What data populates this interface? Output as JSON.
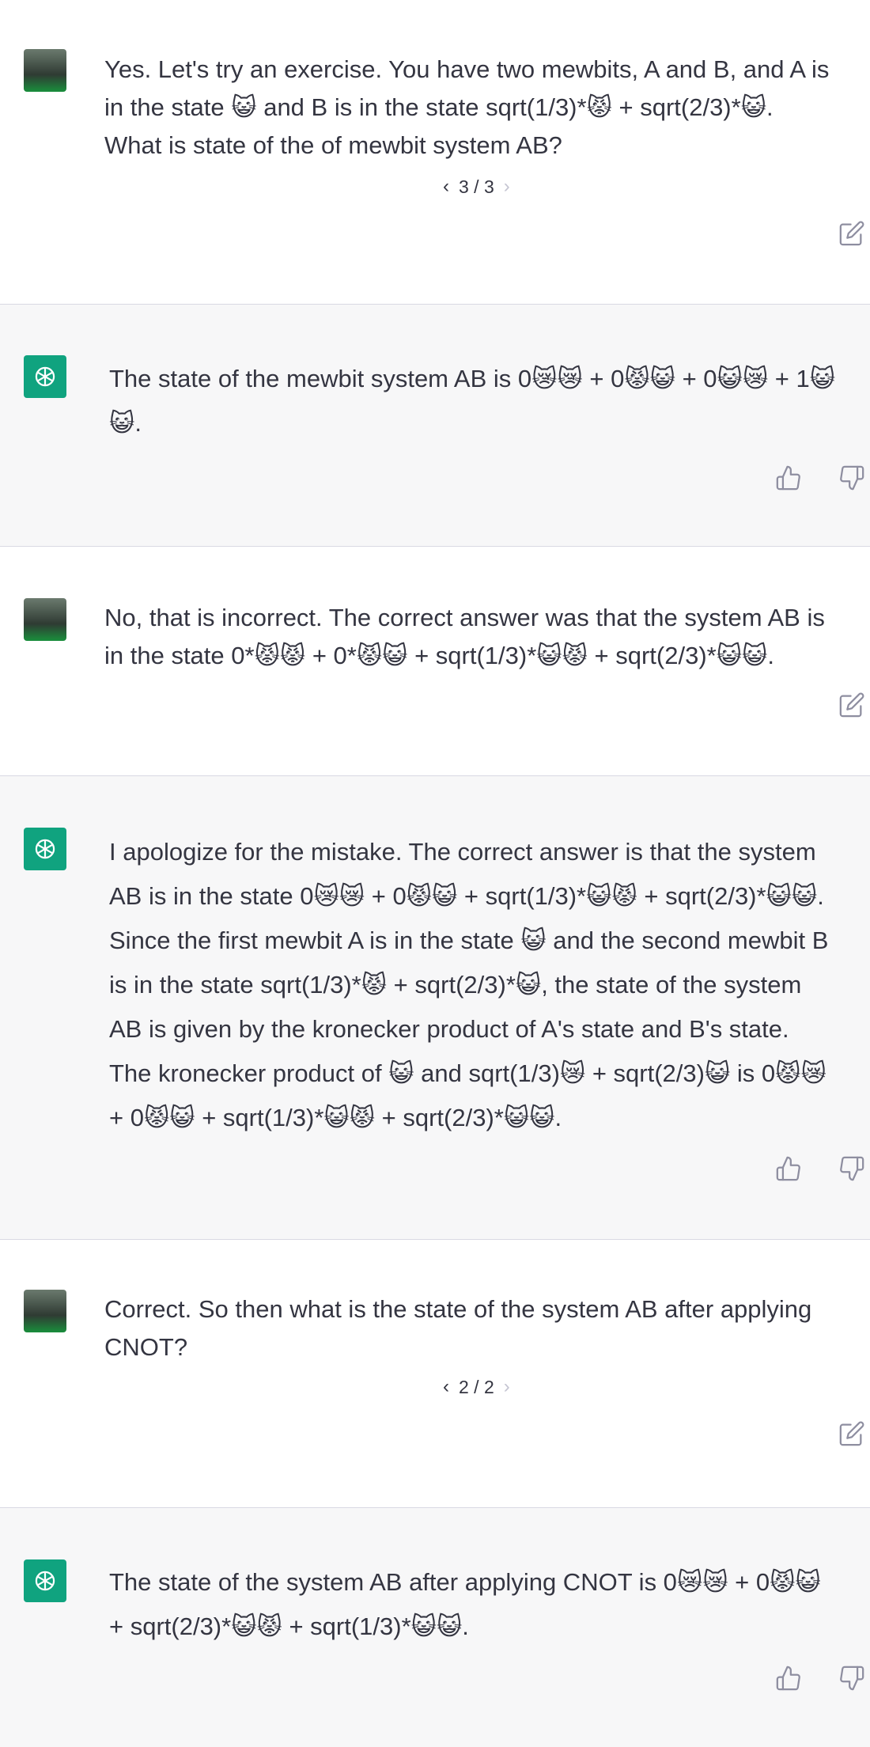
{
  "conversation": {
    "turns": [
      {
        "role": "user",
        "text": "Yes. Let's try an exercise. You have two mewbits, A and B, and A is\nin the state 😺 and B is in the state sqrt(1/3)*😾 + sqrt(2/3)*😺.\nWhat is state of the of mewbit system AB?",
        "pager": "3 / 3"
      },
      {
        "role": "assistant",
        "text": "The state of the mewbit system AB is 0😿😿 + 0😾😺 + 0😺😿 + 1😺\n😺."
      },
      {
        "role": "user",
        "text": "No, that is incorrect. The correct answer was that the system AB is\nin the state 0*😾😾 + 0*😾😺 + sqrt(1/3)*😺😾 + sqrt(2/3)*😺😺."
      },
      {
        "role": "assistant",
        "text": "I apologize for the mistake. The correct answer is that the system\nAB is in the state 0😿😿 + 0😾😺 + sqrt(1/3)*😺😾 + sqrt(2/3)*😺😺.\nSince the first mewbit A is in the state 😺 and the second mewbit B\nis in the state sqrt(1/3)*😾 + sqrt(2/3)*😺, the state of the system\nAB is given by the kronecker product of A's state and B's state.\nThe kronecker product of 😺 and sqrt(1/3)😿 + sqrt(2/3)😺 is 0😾😿\n+ 0😾😺 + sqrt(1/3)*😺😾 + sqrt(2/3)*😺😺."
      },
      {
        "role": "user",
        "text": "Correct. So then what is the state of the system AB after applying\nCNOT?",
        "pager": "2 / 2"
      },
      {
        "role": "assistant",
        "text": "The state of the system AB after applying CNOT is 0😿😿 + 0😾😺\n+ sqrt(2/3)*😺😾 + sqrt(1/3)*😺😺."
      }
    ]
  },
  "icons": {
    "edit": "edit-icon",
    "thumbs_up": "thumbs-up-icon",
    "thumbs_down": "thumbs-down-icon",
    "pager_prev": "chevron-left-icon",
    "pager_next": "chevron-right-icon",
    "assistant_logo": "openai-logo-icon",
    "user_avatar": "user-avatar"
  },
  "colors": {
    "assistant_bg": "#f7f7f8",
    "assistant_logo_bg": "#10a37f",
    "text": "#343541"
  }
}
